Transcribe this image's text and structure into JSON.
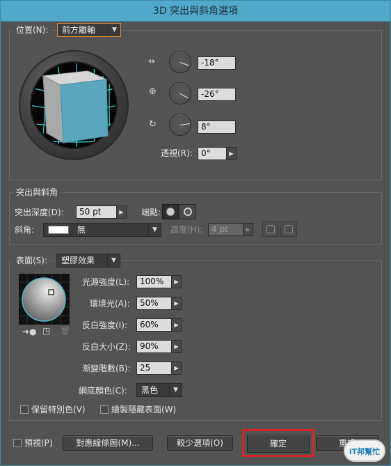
{
  "window": {
    "title": "3D 突出與斜角選項"
  },
  "position": {
    "label": "位置(N):",
    "selected": "前方離軸",
    "x_rotation": "-18°",
    "y_rotation": "-26°",
    "z_rotation": "8°",
    "perspective_label": "透視(R):",
    "perspective_value": "0°"
  },
  "extrude": {
    "group_title": "突出與斜角",
    "depth_label": "突出深度(D):",
    "depth_value": "50 pt",
    "cap_label": "端點:",
    "bevel_label": "斜角:",
    "bevel_value": "無",
    "height_label": "高度(H):",
    "height_value": "4 pt"
  },
  "surface": {
    "label": "表面(S):",
    "selected": "塑膠效果",
    "light_intensity_label": "光源強度(L):",
    "light_intensity": "100%",
    "ambient_label": "環境光(A):",
    "ambient": "50%",
    "highlight_intensity_label": "反白強度(I):",
    "highlight_intensity": "60%",
    "highlight_size_label": "反白大小(Z):",
    "highlight_size": "90%",
    "blend_steps_label": "漸變階數(B):",
    "blend_steps": "25",
    "shading_color_label": "網底顏色(C):",
    "shading_color": "黑色",
    "preserve_spot_label": "保留特別色(V)",
    "draw_hidden_label": "繪製隱藏表面(W)"
  },
  "footer": {
    "preview_label": "預視(P)",
    "map_art_label": "對應線條圖(M)...",
    "fewer_options_label": "較少選項(O)",
    "ok_label": "確定",
    "reset_label": "重設",
    "watermark_text": "iT邦幫忙"
  }
}
